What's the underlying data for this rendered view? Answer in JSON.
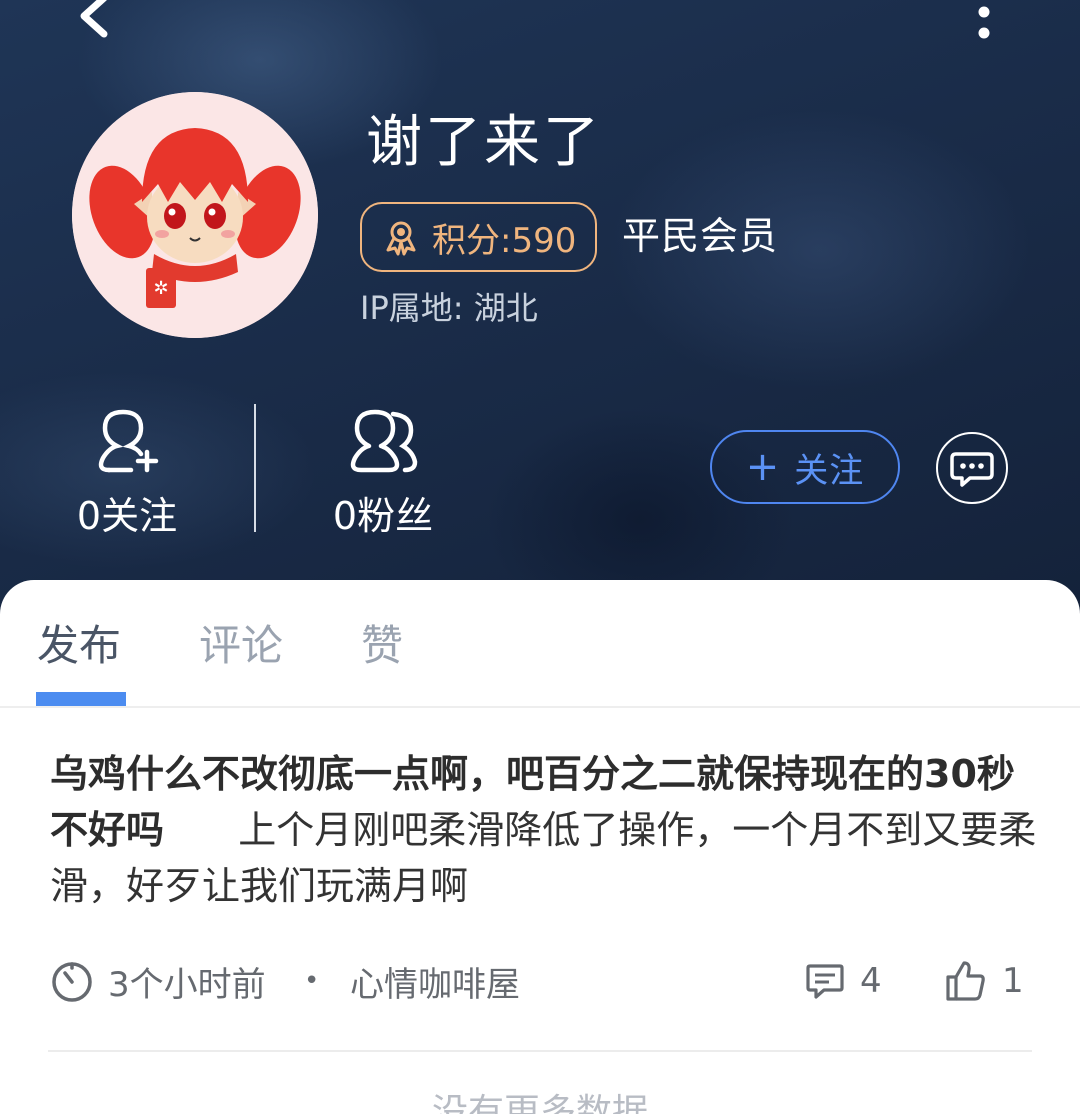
{
  "profile": {
    "username": "谢了来了",
    "points_label": "积分:590",
    "level": "平民会员",
    "ip_location": "IP属地: 湖北"
  },
  "stats": {
    "following_label": "0关注",
    "fans_label": "0粉丝"
  },
  "actions": {
    "follow_plus": "+",
    "follow_label": "关注"
  },
  "tabs": [
    {
      "label": "发布",
      "active": true
    },
    {
      "label": "评论",
      "active": false
    },
    {
      "label": "赞",
      "active": false
    }
  ],
  "posts": [
    {
      "title": "乌鸡什么不改彻底一点啊，吧百分之二就保持现在的30秒不好吗",
      "body": "上个月刚吧柔滑降低了操作，一个月不到又要柔滑，好歹让我们玩满月啊",
      "time": "3个小时前",
      "separator": "•",
      "category": "心情咖啡屋",
      "comments": "4",
      "likes": "1"
    }
  ],
  "footer": {
    "no_more": "没有更多数据"
  },
  "icons": {
    "back": "chevron-left-icon",
    "more": "more-vertical-icon",
    "medal": "medal-icon",
    "follow": "user-plus-icon",
    "fans": "users-icon",
    "message": "chat-bubble-icon",
    "clock": "clock-icon",
    "comment": "comment-icon",
    "like": "thumbs-up-icon"
  },
  "colors": {
    "accent_blue": "#4c8cf0",
    "badge_orange": "#f0b57e",
    "header_bg": "#1a2c49"
  }
}
